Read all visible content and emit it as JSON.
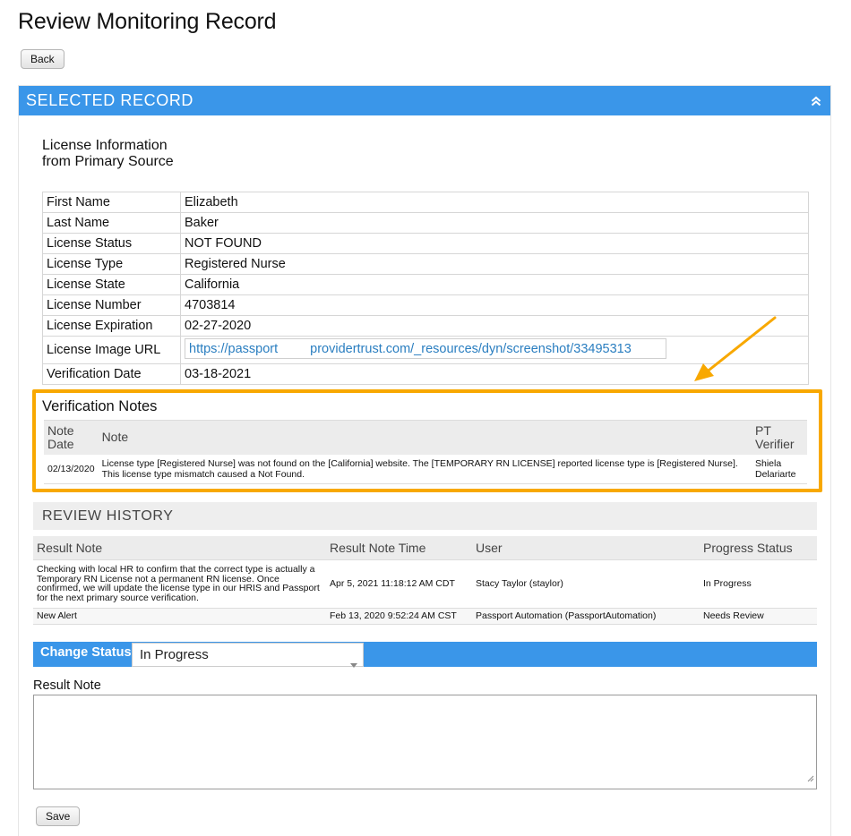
{
  "page": {
    "title": "Review Monitoring Record",
    "back_label": "Back"
  },
  "selected_record": {
    "header": "SELECTED RECORD",
    "collapse_icon": "chevron-double-up-icon",
    "license_heading": "License Information from Primary Source",
    "fields": [
      {
        "label": "First Name",
        "value": "Elizabeth"
      },
      {
        "label": "Last Name",
        "value": "Baker"
      },
      {
        "label": "License Status",
        "value": "NOT FOUND"
      },
      {
        "label": "License Type",
        "value": "Registered Nurse"
      },
      {
        "label": "License State",
        "value": "California"
      },
      {
        "label": "License Number",
        "value": "4703814"
      },
      {
        "label": "License Expiration",
        "value": "02-27-2020"
      },
      {
        "label": "License Image URL",
        "value_part1": "https://passport",
        "value_part2": "providertrust.com/_resources/dyn/screenshot/33495313"
      },
      {
        "label": "Verification Date",
        "value": "03-18-2021"
      }
    ]
  },
  "verification_notes": {
    "title": "Verification Notes",
    "columns": [
      "Note Date",
      "Note",
      "PT Verifier"
    ],
    "rows": [
      {
        "date": "02/13/2020",
        "note": "License type [Registered Nurse] was not found on the [California] website. The [TEMPORARY RN LICENSE] reported license type is [Registered Nurse]. This license type mismatch caused a Not Found.",
        "verifier": "Shiela Delariarte"
      }
    ]
  },
  "review_history": {
    "title": "REVIEW HISTORY",
    "columns": [
      "Result Note",
      "Result Note Time",
      "User",
      "Progress Status"
    ],
    "rows": [
      {
        "note": "Checking with local HR to confirm that the correct type is actually a Temporary RN License not a permanent RN license. Once confirmed, we will update the license type in our HRIS and Passport for the next primary source verification.",
        "time": "Apr 5, 2021 11:18:12 AM CDT",
        "user": "Stacy Taylor (staylor)",
        "status": "In Progress"
      },
      {
        "note": "New Alert",
        "time": "Feb 13, 2020 9:52:24 AM CST",
        "user": "Passport Automation (PassportAutomation)",
        "status": "Needs Review"
      }
    ]
  },
  "change_status": {
    "label": "Change Status",
    "selected": "In Progress"
  },
  "result_note": {
    "label": "Result Note",
    "value": ""
  },
  "save_label": "Save",
  "colors": {
    "accent_blue": "#3a96e9",
    "highlight_orange": "#f8a800",
    "link_blue": "#2a7ec0"
  }
}
